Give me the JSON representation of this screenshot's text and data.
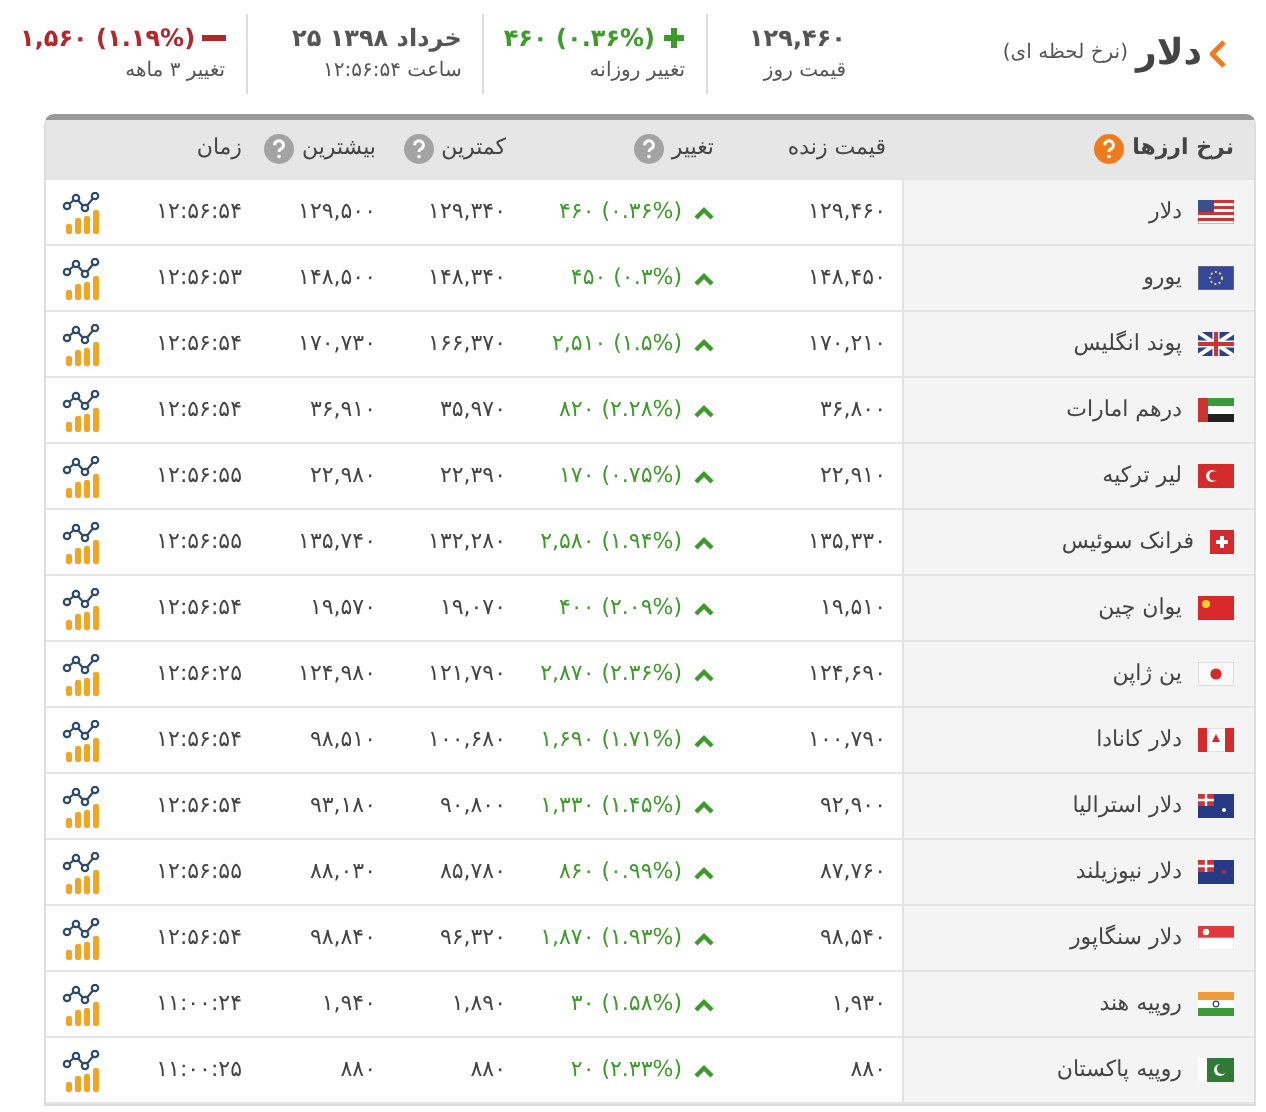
{
  "header": {
    "title": "دلار",
    "subtitle": "(نرخ لحظه ای)",
    "stats": [
      {
        "value": "۱۲۹,۴۶۰",
        "label": "قیمت روز"
      },
      {
        "value": "۴۶۰ (۰.۳۶%)",
        "label": "تغییر روزانه",
        "up": true
      },
      {
        "value": "۲۵ خرداد ۱۳۹۸",
        "label": "ساعت ۱۲:۵۶:۵۴"
      },
      {
        "value": "۱,۵۶۰ (۱.۱۹%)",
        "label": "تغییر ۳ ماهه",
        "up": false
      }
    ]
  },
  "table": {
    "columns": [
      {
        "label": "نرخ ارزها",
        "help": true,
        "color": "#f07b1d"
      },
      {
        "label": "قیمت زنده",
        "help": false
      },
      {
        "label": "تغییر",
        "help": true,
        "color": "#a3a3a3"
      },
      {
        "label": "کمترین",
        "help": true,
        "color": "#a3a3a3"
      },
      {
        "label": "بیشترین",
        "help": true,
        "color": "#a3a3a3"
      },
      {
        "label": "زمان",
        "help": false
      }
    ],
    "rows": [
      {
        "name": "دلار",
        "price": "۱۲۹,۴۶۰",
        "change": "۴۶۰ (۰.۳۶%)",
        "up": true,
        "min": "۱۲۹,۳۴۰",
        "max": "۱۲۹,۵۰۰",
        "time": "۱۲:۵۶:۵۴"
      },
      {
        "name": "یورو",
        "price": "۱۴۸,۴۵۰",
        "change": "۴۵۰ (۰.۳%)",
        "up": true,
        "min": "۱۴۸,۳۴۰",
        "max": "۱۴۸,۵۰۰",
        "time": "۱۲:۵۶:۵۳"
      },
      {
        "name": "پوند انگلیس",
        "price": "۱۷۰,۲۱۰",
        "change": "۲,۵۱۰ (۱.۵%)",
        "up": true,
        "min": "۱۶۶,۳۷۰",
        "max": "۱۷۰,۷۳۰",
        "time": "۱۲:۵۶:۵۴"
      },
      {
        "name": "درهم امارات",
        "price": "۳۶,۸۰۰",
        "change": "۸۲۰ (۲.۲۸%)",
        "up": true,
        "min": "۳۵,۹۷۰",
        "max": "۳۶,۹۱۰",
        "time": "۱۲:۵۶:۵۴"
      },
      {
        "name": "لیر ترکیه",
        "price": "۲۲,۹۱۰",
        "change": "۱۷۰ (۰.۷۵%)",
        "up": true,
        "min": "۲۲,۳۹۰",
        "max": "۲۲,۹۸۰",
        "time": "۱۲:۵۶:۵۵"
      },
      {
        "name": "فرانک سوئیس",
        "price": "۱۳۵,۳۳۰",
        "change": "۲,۵۸۰ (۱.۹۴%)",
        "up": true,
        "min": "۱۳۲,۲۸۰",
        "max": "۱۳۵,۷۴۰",
        "time": "۱۲:۵۶:۵۵"
      },
      {
        "name": "یوان چین",
        "price": "۱۹,۵۱۰",
        "change": "۴۰۰ (۲.۰۹%)",
        "up": true,
        "min": "۱۹,۰۷۰",
        "max": "۱۹,۵۷۰",
        "time": "۱۲:۵۶:۵۴"
      },
      {
        "name": "ین ژاپن",
        "price": "۱۲۴,۶۹۰",
        "change": "۲,۸۷۰ (۲.۳۶%)",
        "up": true,
        "min": "۱۲۱,۷۹۰",
        "max": "۱۲۴,۹۸۰",
        "time": "۱۲:۵۶:۲۵"
      },
      {
        "name": "دلار کانادا",
        "price": "۱۰۰,۷۹۰",
        "change": "۱,۶۹۰ (۱.۷۱%)",
        "up": true,
        "min": "۱۰۰,۶۸۰",
        "max": "۹۸,۵۱۰",
        "time": "۱۲:۵۶:۵۴"
      },
      {
        "name": "دلار استرالیا",
        "price": "۹۲,۹۰۰",
        "change": "۱,۳۳۰ (۱.۴۵%)",
        "up": true,
        "min": "۹۰,۸۰۰",
        "max": "۹۳,۱۸۰",
        "time": "۱۲:۵۶:۵۴"
      },
      {
        "name": "دلار نیوزیلند",
        "price": "۸۷,۷۶۰",
        "change": "۸۶۰ (۰.۹۹%)",
        "up": true,
        "min": "۸۵,۷۸۰",
        "max": "۸۸,۰۳۰",
        "time": "۱۲:۵۶:۵۵"
      },
      {
        "name": "دلار سنگاپور",
        "price": "۹۸,۵۴۰",
        "change": "۱,۸۷۰ (۱.۹۳%)",
        "up": true,
        "min": "۹۶,۳۲۰",
        "max": "۹۸,۸۴۰",
        "time": "۱۲:۵۶:۵۴"
      },
      {
        "name": "روپیه هند",
        "price": "۱,۹۳۰",
        "change": "۳۰ (۱.۵۸%)",
        "up": true,
        "min": "۱,۸۹۰",
        "max": "۱,۹۴۰",
        "time": "۱۱:۰۰:۲۴"
      },
      {
        "name": "روپیه پاکستان",
        "price": "۸۸۰",
        "change": "۲۰ (۲.۳۳%)",
        "up": true,
        "min": "۸۸۰",
        "max": "۸۸۰",
        "time": "۱۱:۰۰:۲۵"
      }
    ]
  }
}
